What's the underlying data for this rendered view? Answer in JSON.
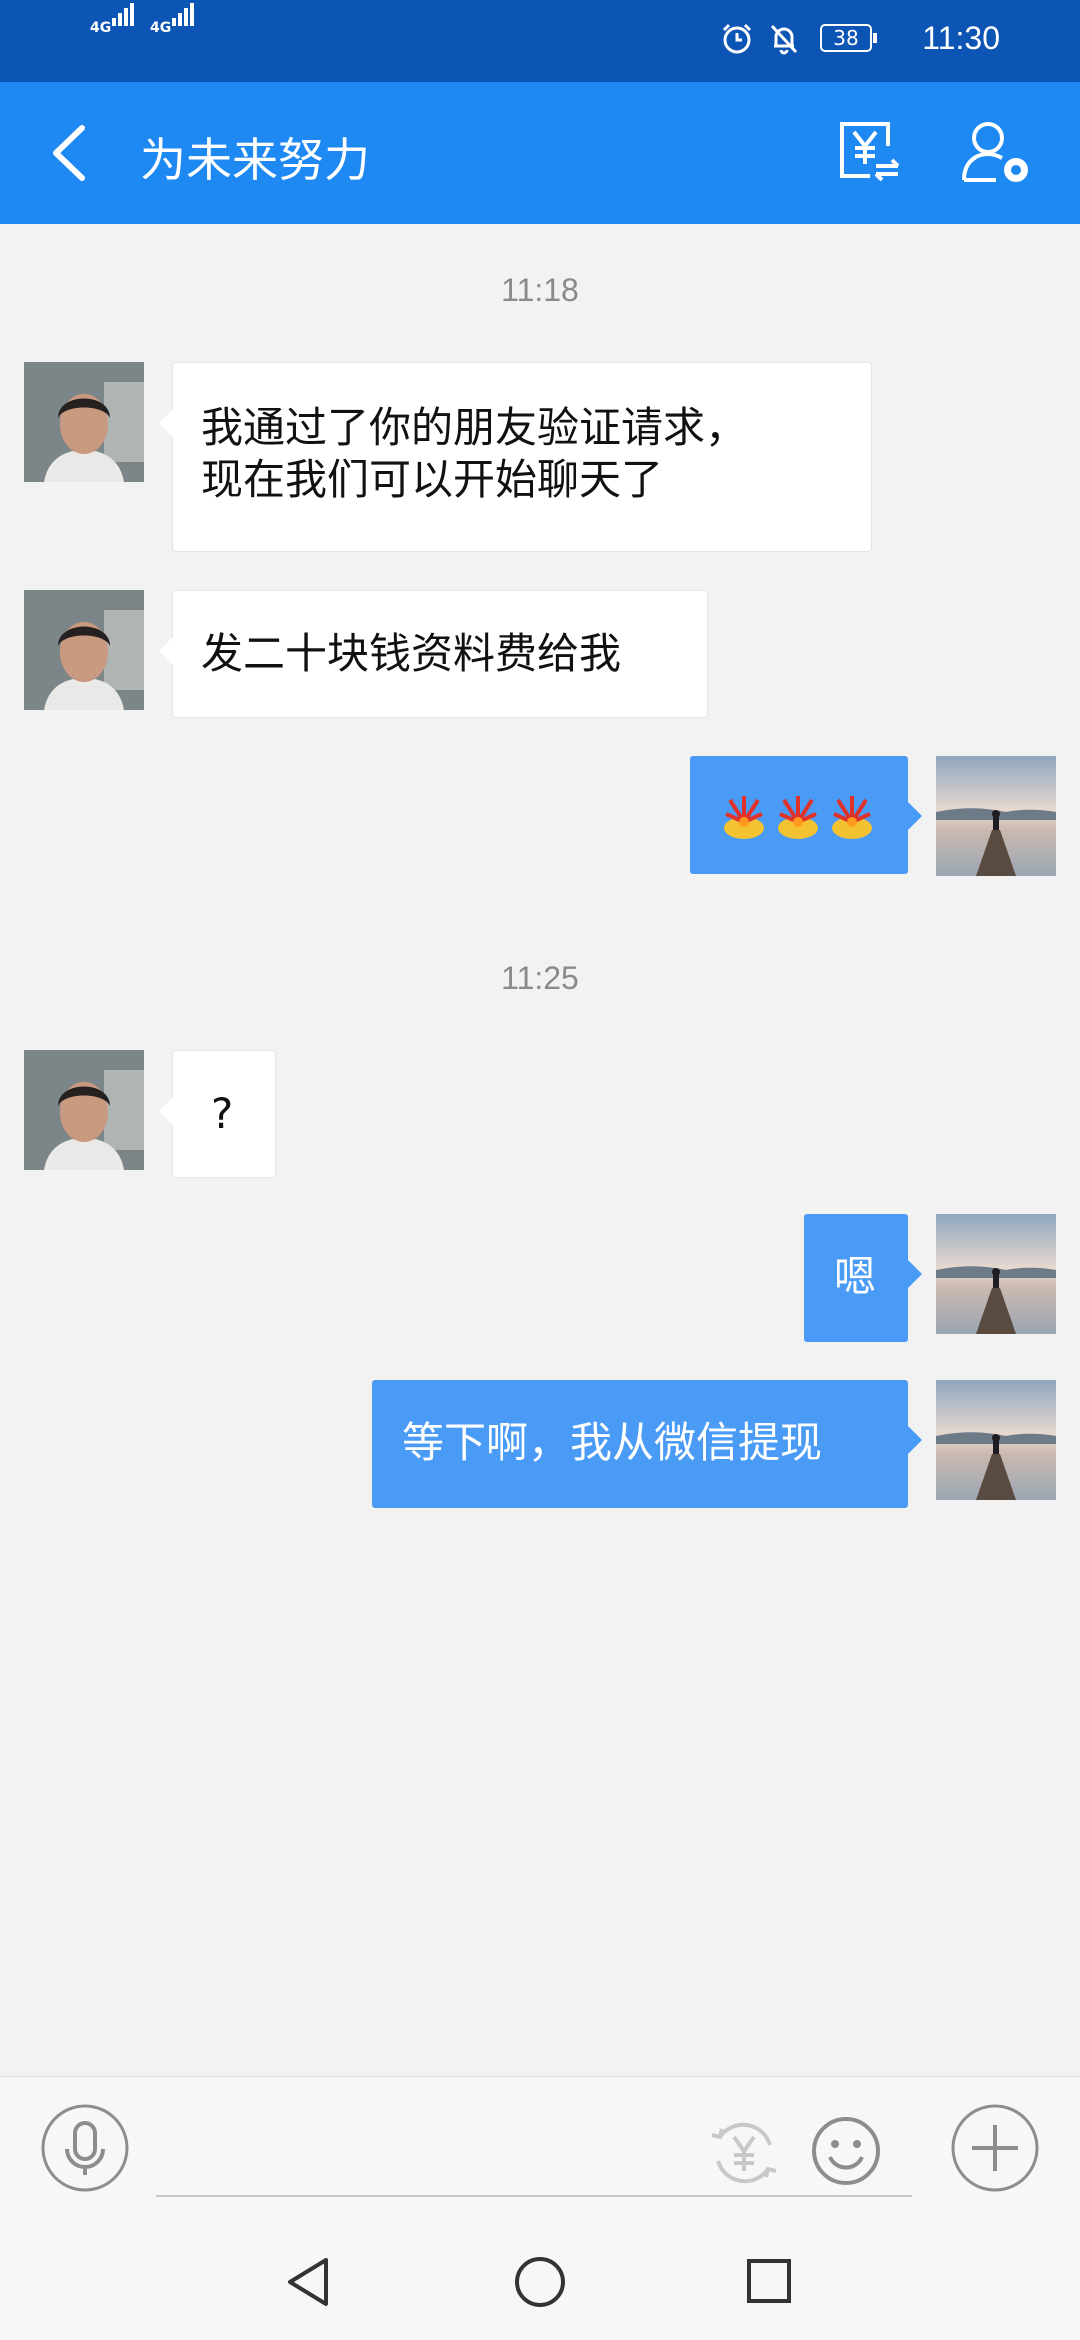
{
  "status_bar": {
    "signal1_label": "4G",
    "signal2_label": "4G",
    "battery_level": "38",
    "time": "11:30",
    "icons": [
      "alarm-icon",
      "mute-bell-icon",
      "battery-icon"
    ]
  },
  "header": {
    "title": "为未来努力",
    "back_icon": "chevron-left-icon",
    "actions": [
      "transfer-money-icon",
      "contact-settings-icon"
    ]
  },
  "chat": {
    "timestamps": [
      "11:18",
      "11:25"
    ],
    "messages": [
      {
        "side": "in",
        "lines": [
          "我通过了你的朋友验证请求，",
          "现在我们可以开始聊天了"
        ]
      },
      {
        "side": "in",
        "lines": [
          "发二十块钱资料费给我"
        ]
      },
      {
        "side": "out",
        "emoji": [
          "fireworks-emoji",
          "fireworks-emoji",
          "fireworks-emoji"
        ]
      },
      {
        "side": "in",
        "lines": [
          "?"
        ]
      },
      {
        "side": "out",
        "lines": [
          "嗯"
        ]
      },
      {
        "side": "out",
        "lines": [
          "等下啊，我从微信提现"
        ]
      }
    ]
  },
  "input_bar": {
    "placeholder": "",
    "icons": [
      "microphone-icon",
      "red-packet-icon",
      "emoji-icon",
      "plus-icon"
    ]
  },
  "nav_bar": {
    "icons": [
      "nav-back-icon",
      "nav-home-icon",
      "nav-recents-icon"
    ]
  },
  "colors": {
    "status_bar": "#0d55b5",
    "header": "#1e89f3",
    "chat_background": "#f2f2f2",
    "outgoing_bubble": "#4a9bf5",
    "incoming_bubble": "#ffffff"
  }
}
